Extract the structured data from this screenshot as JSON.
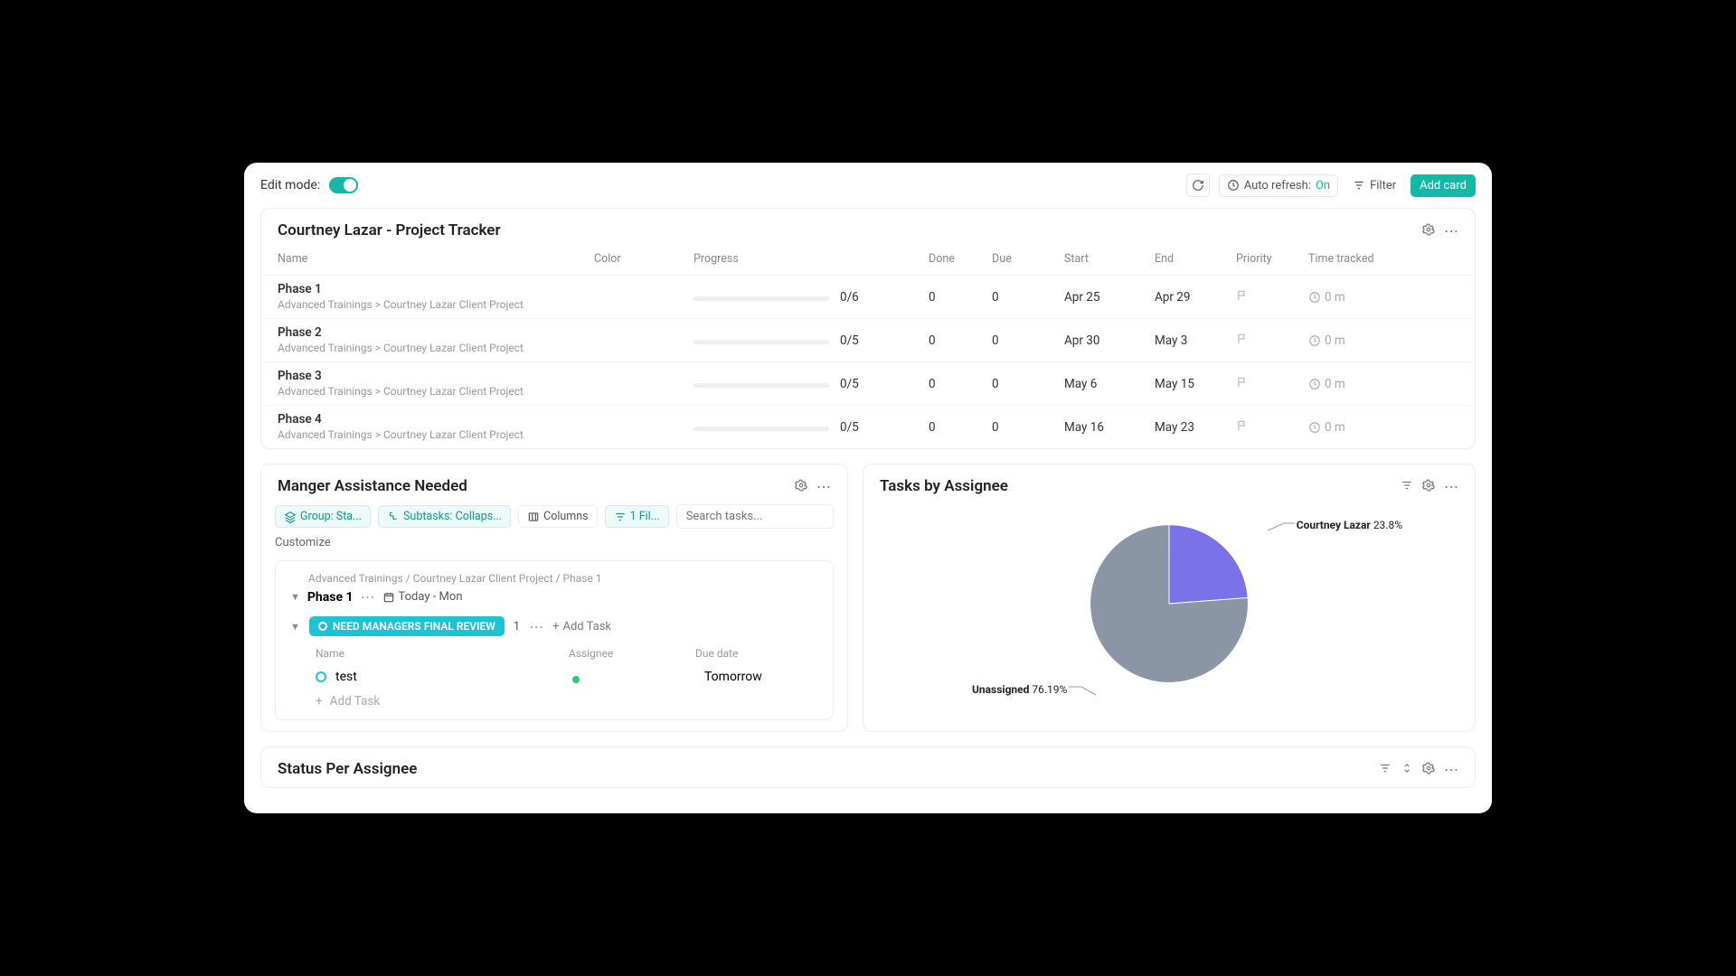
{
  "toolbar": {
    "edit_mode_label": "Edit mode:",
    "auto_refresh_label": "Auto refresh:",
    "auto_refresh_state": "On",
    "filter_label": "Filter",
    "add_card_label": "Add card"
  },
  "tracker": {
    "title": "Courtney Lazar - Project Tracker",
    "columns": [
      "Name",
      "Color",
      "Progress",
      "Done",
      "Due",
      "Start",
      "End",
      "Priority",
      "Time tracked"
    ],
    "rows": [
      {
        "name": "Phase 1",
        "path": "Advanced Trainings > Courtney Lazar Client Project",
        "progress": "0/6",
        "done": "0",
        "due": "0",
        "start": "Apr 25",
        "end": "Apr 29",
        "time": "0 m"
      },
      {
        "name": "Phase 2",
        "path": "Advanced Trainings > Courtney Lazar Client Project",
        "progress": "0/5",
        "done": "0",
        "due": "0",
        "start": "Apr 30",
        "end": "May 3",
        "time": "0 m"
      },
      {
        "name": "Phase 3",
        "path": "Advanced Trainings > Courtney Lazar Client Project",
        "progress": "0/5",
        "done": "0",
        "due": "0",
        "start": "May 6",
        "end": "May 15",
        "time": "0 m"
      },
      {
        "name": "Phase 4",
        "path": "Advanced Trainings > Courtney Lazar Client Project",
        "progress": "0/5",
        "done": "0",
        "due": "0",
        "start": "May 16",
        "end": "May 23",
        "time": "0 m"
      }
    ]
  },
  "assistance": {
    "title": "Manger Assistance Needed",
    "chips": {
      "group": "Group: Sta...",
      "subtasks": "Subtasks: Collaps...",
      "columns": "Columns",
      "filter": "1 Fil..."
    },
    "search_placeholder": "Search tasks...",
    "customize": "Customize",
    "breadcrumb": "Advanced Trainings / Courtney Lazar Client Project / Phase 1",
    "phase_name": "Phase 1",
    "phase_date": "Today - Mon",
    "status_label": "NEED MANAGERS FINAL REVIEW",
    "status_count": "1",
    "add_task": "Add Task",
    "inner_headers": {
      "name": "Name",
      "assignee": "Assignee",
      "due_date": "Due date"
    },
    "task": {
      "name": "test",
      "due": "Tomorrow"
    },
    "add_task_placeholder": "Add Task"
  },
  "assignee_pie": {
    "title": "Tasks by Assignee",
    "labels": {
      "courtney_name": "Courtney Lazar",
      "courtney_pct": "23.8%",
      "unassigned_name": "Unassigned",
      "unassigned_pct": "76.19%"
    }
  },
  "status_card": {
    "title": "Status Per Assignee"
  },
  "chart_data": {
    "type": "pie",
    "title": "Tasks by Assignee",
    "series": [
      {
        "name": "Courtney Lazar",
        "value": 23.8,
        "color": "#7b72e9"
      },
      {
        "name": "Unassigned",
        "value": 76.19,
        "color": "#8a95a5"
      }
    ]
  }
}
